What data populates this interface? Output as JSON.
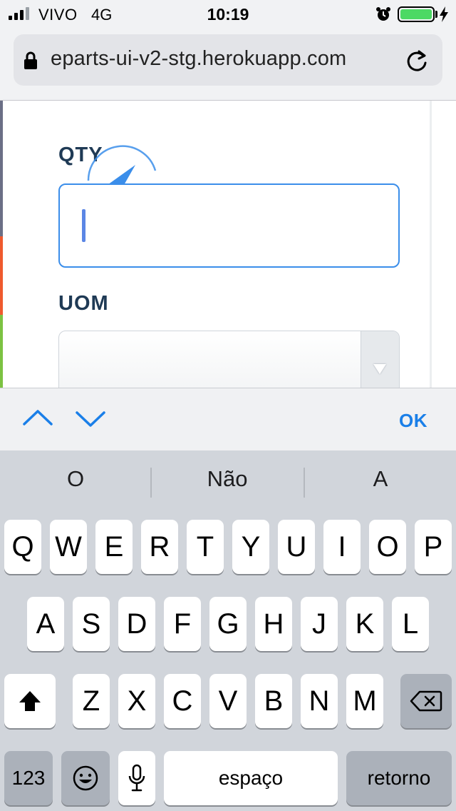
{
  "status_bar": {
    "carrier": "VIVO",
    "network": "4G",
    "time": "10:19",
    "signal_bars_filled": 3,
    "signal_bars_total": 4,
    "battery_level": 1.0,
    "icons": [
      "signal-icon",
      "alarm-icon",
      "battery-icon",
      "charging-bolt-icon"
    ],
    "battery_color": "#4cd964"
  },
  "browser": {
    "url": "eparts-ui-v2-stg.herokuapp.com",
    "icons": [
      "lock-icon",
      "reload-icon"
    ]
  },
  "form": {
    "qty_label": "QTY",
    "qty_value": "",
    "uom_label": "UOM",
    "uom_value": "",
    "label_color": "#1f3a55",
    "focus_color": "#3b8eea"
  },
  "accessory_bar": {
    "ok_label": "OK",
    "icons": [
      "chevron-up-icon",
      "chevron-down-icon"
    ],
    "accent_color": "#1a7fe8"
  },
  "keyboard": {
    "suggestions": [
      "O",
      "Não",
      "A"
    ],
    "rows": [
      [
        "Q",
        "W",
        "E",
        "R",
        "T",
        "Y",
        "U",
        "I",
        "O",
        "P"
      ],
      [
        "A",
        "S",
        "D",
        "F",
        "G",
        "H",
        "J",
        "K",
        "L"
      ],
      [
        "Z",
        "X",
        "C",
        "V",
        "B",
        "N",
        "M"
      ]
    ],
    "numbers_key": "123",
    "space_key": "espaço",
    "return_key": "retorno",
    "icons": [
      "shift-icon",
      "delete-icon",
      "emoji-icon",
      "microphone-icon"
    ]
  }
}
